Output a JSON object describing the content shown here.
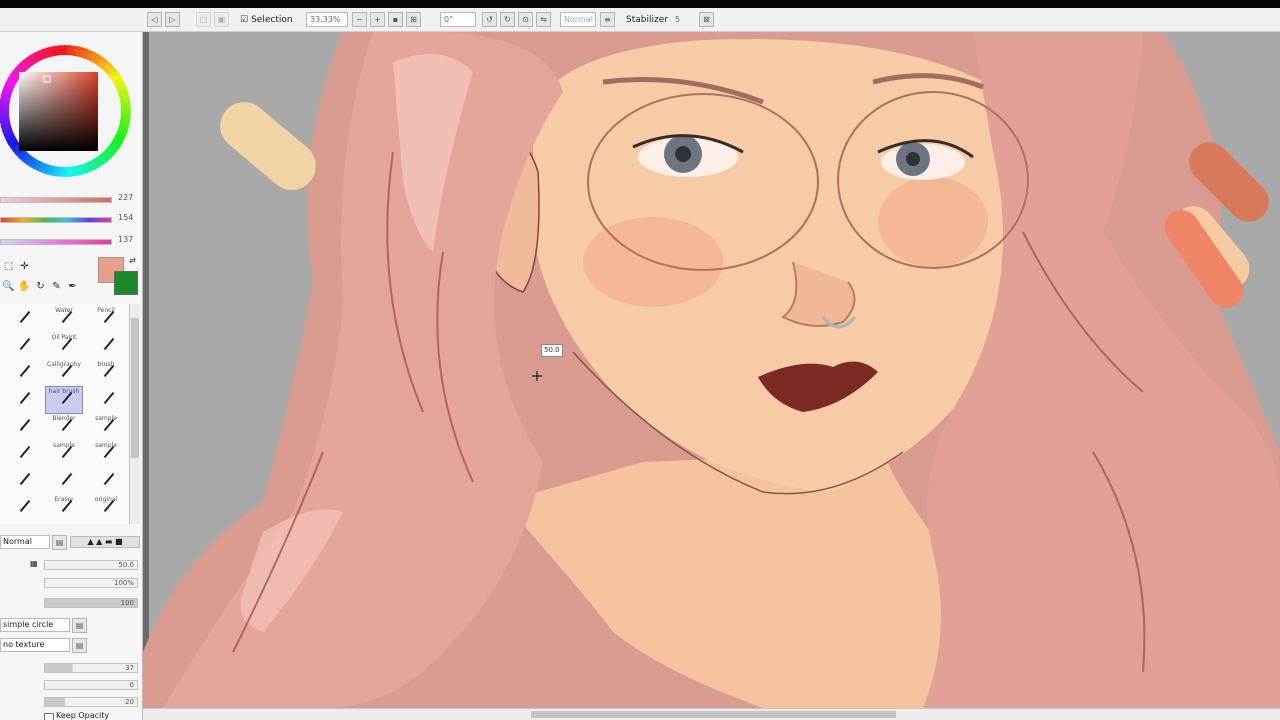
{
  "toolbar": {
    "selection_label": "Selection",
    "zoom_value": "33.33%",
    "rotation_value": "0°",
    "blend_mode": "Normal",
    "stabilizer_label": "Stabilizer",
    "stabilizer_value": "5"
  },
  "color": {
    "wheel_icon": "color-wheel",
    "primary_hex": "#e8a08c",
    "secondary_hex": "#1d8a2a",
    "sliders": [
      {
        "name": "hue",
        "value": "227"
      },
      {
        "name": "saturation",
        "value": "154"
      },
      {
        "name": "value",
        "value": "137"
      }
    ]
  },
  "brushes": [
    [
      "",
      "Water",
      "Pencil"
    ],
    [
      "",
      "Oil Paint",
      ""
    ],
    [
      "",
      "Calligraphy",
      "brush"
    ],
    [
      "",
      "hair brush",
      ""
    ],
    [
      "",
      "Blender",
      "sample"
    ],
    [
      "",
      "sample",
      "sample"
    ],
    [
      "",
      "",
      ""
    ],
    [
      "",
      "Eraser",
      "original"
    ]
  ],
  "brush_settings": {
    "mode_label": "Normal",
    "size_value": "50.0",
    "min_size_value": "100%",
    "density_value": "100",
    "shape_label": "simple circle",
    "texture_label": "no texture",
    "blending_value": "37",
    "dilution_value": "0",
    "persistence_value": "20",
    "keep_opacity_label": "Keep Opacity"
  },
  "canvas": {
    "tooltip": "50.0",
    "palette": [
      "#f1d3a4",
      "#d8795a",
      "#f7cba1",
      "#ef8466"
    ]
  }
}
